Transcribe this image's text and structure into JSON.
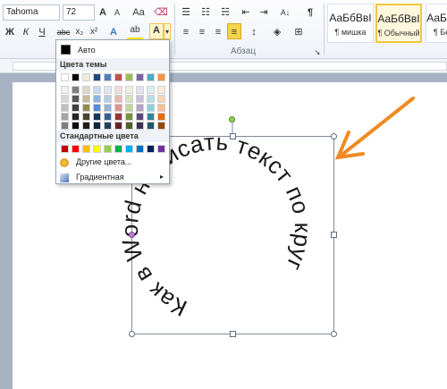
{
  "toolbar": {
    "font_name": "Tahoma",
    "font_size": "72",
    "grow_font": "A",
    "shrink_font": "A",
    "change_case": "Aa",
    "bold": "Ж",
    "italic": "К",
    "underline": "Ч",
    "strikethrough": "abc",
    "subscript": "x₂",
    "superscript": "x²",
    "text_effects": "A",
    "highlight": "ab",
    "font_color": "A",
    "paragraph_mark": "¶",
    "paragraph_group": "Абзац"
  },
  "styles": [
    {
      "sample": "АаБбВвІ",
      "name": "¶ мишка"
    },
    {
      "sample": "АаБбВвІ",
      "name": "¶ Обычный"
    },
    {
      "sample": "АаБбВ",
      "name": "¶ Без"
    }
  ],
  "color_menu": {
    "auto_label": "Авто",
    "theme_header": "Цвета темы",
    "standard_header": "Стандартные цвета",
    "more_colors": "Другие цвета...",
    "gradient": "Градиентная",
    "theme_colors": [
      [
        "#ffffff",
        "#000000",
        "#eeece1",
        "#1f497d",
        "#4f81bd",
        "#c0504d",
        "#9bbb59",
        "#8064a2",
        "#4bacc6",
        "#f79646"
      ],
      [
        "#f2f2f2",
        "#7f7f7f",
        "#ddd9c3",
        "#c6d9f0",
        "#dbe5f1",
        "#f2dcdb",
        "#ebf1dd",
        "#e5e0ec",
        "#dbeef3",
        "#fdeada"
      ],
      [
        "#d8d8d8",
        "#595959",
        "#c4bd97",
        "#8db3e2",
        "#b8cce4",
        "#e5b9b7",
        "#d7e3bc",
        "#ccc1d9",
        "#b7dde8",
        "#fbd5b5"
      ],
      [
        "#bfbfbf",
        "#3f3f3f",
        "#938953",
        "#548dd4",
        "#95b3d7",
        "#d99694",
        "#c3d69b",
        "#b2a2c7",
        "#92cddc",
        "#fac08f"
      ],
      [
        "#a5a5a5",
        "#262626",
        "#494429",
        "#17365d",
        "#366092",
        "#953734",
        "#76923c",
        "#5f497a",
        "#31859b",
        "#e36c09"
      ],
      [
        "#7f7f7f",
        "#0c0c0c",
        "#1d1b10",
        "#0f243e",
        "#244061",
        "#632423",
        "#4f6128",
        "#3f3151",
        "#205867",
        "#974806"
      ]
    ],
    "standard_colors": [
      "#c00000",
      "#ff0000",
      "#ffc000",
      "#ffff00",
      "#92d050",
      "#00b050",
      "#00b0f0",
      "#0070c0",
      "#002060",
      "#7030a0"
    ]
  },
  "document": {
    "circle_text": "Как в Word написать текст по кругу"
  },
  "colors": {
    "arrow": "#f08a24",
    "font_color_bar": "#e01010"
  }
}
